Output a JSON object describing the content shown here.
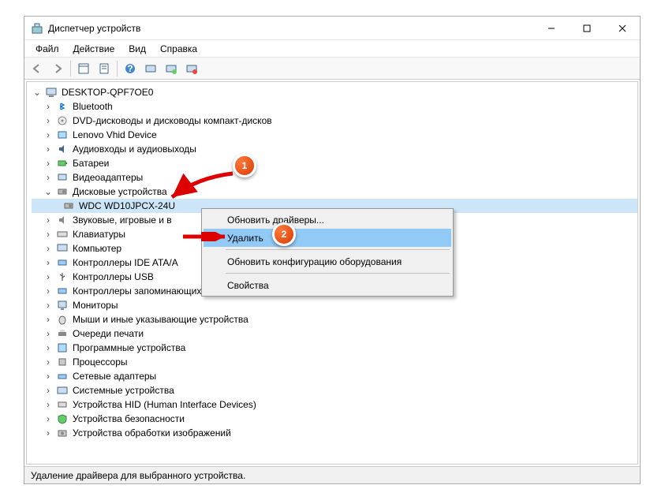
{
  "window": {
    "title": "Диспетчер устройств"
  },
  "menu": {
    "file": "Файл",
    "action": "Действие",
    "view": "Вид",
    "help": "Справка"
  },
  "tree": {
    "root": "DESKTOP-QPF7OE0",
    "nodes": {
      "bluetooth": "Bluetooth",
      "dvd": "DVD-дисководы и дисководы компакт-дисков",
      "lenovo": "Lenovo Vhid Device",
      "audio": "Аудиовходы и аудиовыходы",
      "battery": "Батареи",
      "video": "Видеоадаптеры",
      "disk": "Дисковые устройства",
      "disk_child": "WDC WD10JPCX-24U",
      "sound": "Звуковые, игровые и в",
      "keyboard": "Клавиатуры",
      "computer": "Компьютер",
      "ide": "Контроллеры IDE ATA/A",
      "usb": "Контроллеры USB",
      "storage": "Контроллеры запоминающих устройств",
      "monitor": "Мониторы",
      "mouse": "Мыши и иные указывающие устройства",
      "print": "Очереди печати",
      "software": "Программные устройства",
      "cpu": "Процессоры",
      "net": "Сетевые адаптеры",
      "sys": "Системные устройства",
      "hid": "Устройства HID (Human Interface Devices)",
      "security": "Устройства безопасности",
      "imaging": "Устройства обработки изображений"
    }
  },
  "context_menu": {
    "update_driver": "Обновить драйверы...",
    "delete": "Удалить",
    "scan_hw": "Обновить конфигурацию оборудования",
    "properties": "Свойства"
  },
  "statusbar": {
    "text": "Удаление драйвера для выбранного устройства."
  },
  "markers": {
    "m1": "1",
    "m2": "2"
  }
}
